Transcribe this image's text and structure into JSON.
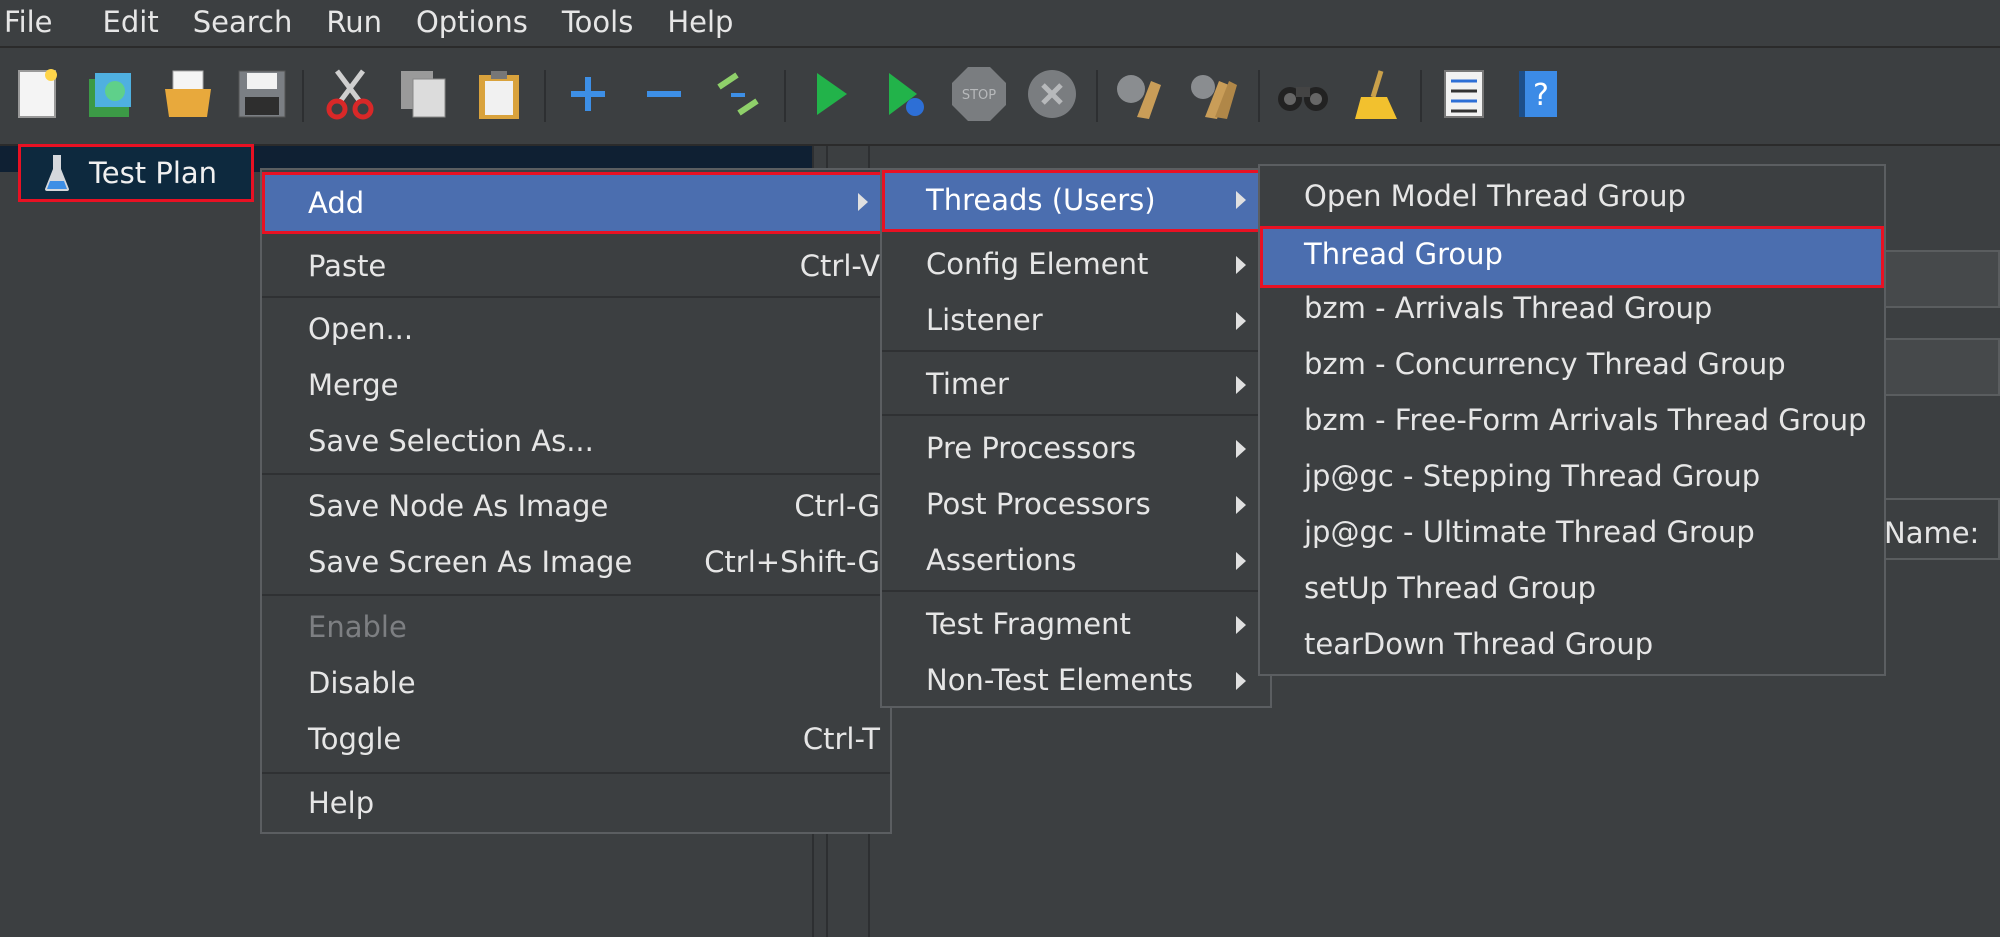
{
  "menubar": {
    "items": [
      {
        "label": "File"
      },
      {
        "label": "Edit"
      },
      {
        "label": "Search"
      },
      {
        "label": "Run"
      },
      {
        "label": "Options"
      },
      {
        "label": "Tools"
      },
      {
        "label": "Help"
      }
    ]
  },
  "toolbar": {
    "icons": [
      "new-icon",
      "templates-icon",
      "open-icon",
      "save-icon",
      "cut-icon",
      "copy-icon",
      "paste-icon",
      "expand-icon",
      "collapse-icon",
      "toggle-icon",
      "start-icon",
      "start-no-pauses-icon",
      "stop-icon",
      "shutdown-icon",
      "clear-icon",
      "clear-all-icon",
      "search-icon",
      "reset-search-icon",
      "function-helper-icon",
      "help-icon"
    ]
  },
  "tree": {
    "root_label": "Test Plan",
    "root_icon": "flask-icon"
  },
  "right_panel": {
    "name_label": "Name:"
  },
  "context_menu": {
    "items": {
      "add": "Add",
      "paste": "Paste",
      "paste_shortcut": "Ctrl-V",
      "open": "Open...",
      "merge": "Merge",
      "save_selection": "Save Selection As...",
      "save_node_image": "Save Node As Image",
      "save_node_image_shortcut": "Ctrl-G",
      "save_screen_image": "Save Screen As Image",
      "save_screen_image_shortcut": "Ctrl+Shift-G",
      "enable": "Enable",
      "disable": "Disable",
      "toggle": "Toggle",
      "toggle_shortcut": "Ctrl-T",
      "help": "Help"
    }
  },
  "add_submenu": {
    "items": {
      "threads": "Threads (Users)",
      "config": "Config Element",
      "listener": "Listener",
      "timer": "Timer",
      "pre": "Pre Processors",
      "post": "Post Processors",
      "assertions": "Assertions",
      "fragment": "Test Fragment",
      "non_test": "Non-Test Elements"
    }
  },
  "threads_submenu": {
    "items": [
      "Open Model Thread Group",
      "Thread Group",
      "bzm - Arrivals Thread Group",
      "bzm - Concurrency Thread Group",
      "bzm - Free-Form Arrivals Thread Group",
      "jp@gc - Stepping Thread Group",
      "jp@gc - Ultimate Thread Group",
      "setUp Thread Group",
      "tearDown Thread Group"
    ]
  },
  "colors": {
    "background": "#3c3f41",
    "highlight": "#4b6eaf",
    "annotation_red": "#e81123"
  }
}
